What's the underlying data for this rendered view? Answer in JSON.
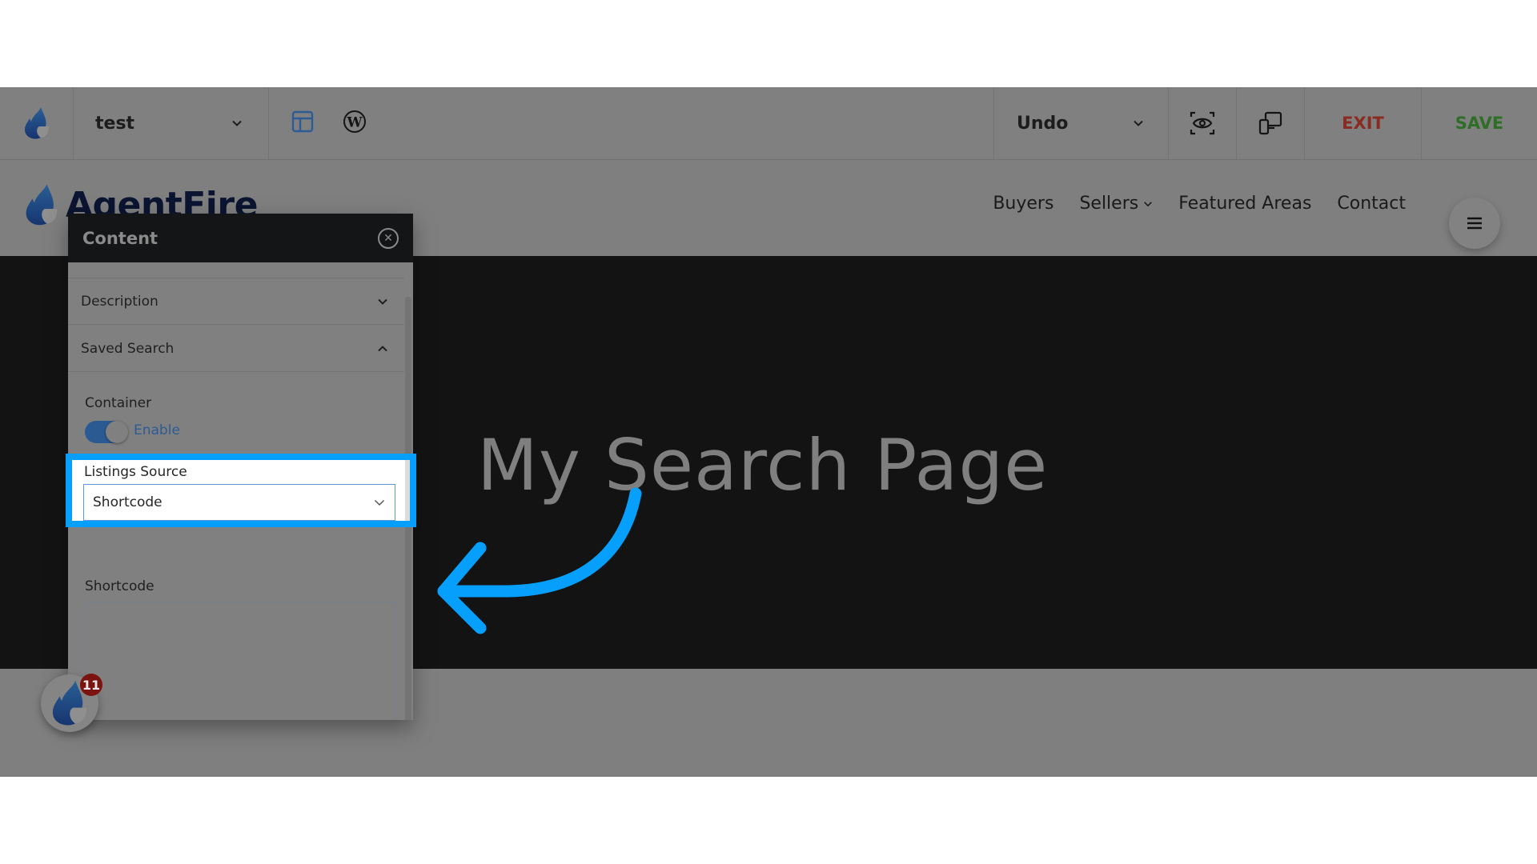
{
  "toolbar": {
    "page_name": "test",
    "undo_label": "Undo",
    "exit_label": "EXIT",
    "save_label": "SAVE",
    "icons": [
      "agentfire-flame-icon",
      "layout-icon",
      "wordpress-icon",
      "preview-eye-icon",
      "responsive-devices-icon"
    ],
    "colors": {
      "exit": "#8a2b22",
      "save": "#2f6e26",
      "layout_icon": "#2d5b93"
    }
  },
  "site": {
    "brand": "AgentFire",
    "nav": [
      {
        "label": "Buyers",
        "has_dropdown": false
      },
      {
        "label": "Sellers",
        "has_dropdown": true
      },
      {
        "label": "Featured Areas",
        "has_dropdown": false
      },
      {
        "label": "Contact",
        "has_dropdown": false
      }
    ],
    "hero_title": "My Search Page"
  },
  "panel": {
    "title": "Content",
    "sections": [
      {
        "label": "Description",
        "expanded": false
      },
      {
        "label": "Saved Search",
        "expanded": true
      }
    ],
    "container_label": "Container",
    "container_toggle": {
      "state": "on",
      "label": "Enable"
    },
    "listings_source_label": "Listings Source",
    "listings_source_value": "Shortcode",
    "shortcode_label": "Shortcode",
    "shortcode_value": ""
  },
  "notification_badge": {
    "count": "11"
  },
  "annotation": {
    "highlight_color": "#069ffb",
    "target": "Listings Source"
  }
}
